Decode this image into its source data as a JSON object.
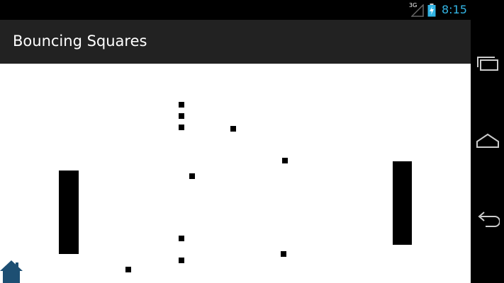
{
  "status_bar": {
    "network": "3G",
    "time": "8:15",
    "time_color": "#33b5e5"
  },
  "app": {
    "title": "Bouncing Squares"
  },
  "game": {
    "background": "#ffffff",
    "square_color": "#000000"
  },
  "navigation": {
    "buttons": [
      "recent-apps",
      "home",
      "back"
    ]
  },
  "icons": {
    "signal": "signal-icon",
    "battery": "battery-charging-icon",
    "home_overlay": "home-icon"
  }
}
